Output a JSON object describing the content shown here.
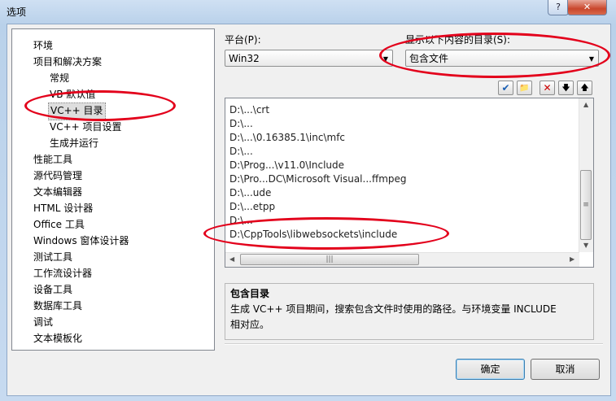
{
  "window": {
    "title": "选项",
    "help_label": "?",
    "close_label": "✕"
  },
  "tree": {
    "items": [
      {
        "label": "环境",
        "level": 0
      },
      {
        "label": "项目和解决方案",
        "level": 0
      },
      {
        "label": "常规",
        "level": 1
      },
      {
        "label": "VB 默认值",
        "level": 1
      },
      {
        "label": "VC++ 目录",
        "level": 1,
        "selected": true
      },
      {
        "label": "VC++ 项目设置",
        "level": 1
      },
      {
        "label": "生成并运行",
        "level": 1
      },
      {
        "label": "性能工具",
        "level": 0
      },
      {
        "label": "源代码管理",
        "level": 0
      },
      {
        "label": "文本编辑器",
        "level": 0
      },
      {
        "label": "HTML 设计器",
        "level": 0
      },
      {
        "label": "Office 工具",
        "level": 0
      },
      {
        "label": "Windows 窗体设计器",
        "level": 0
      },
      {
        "label": "测试工具",
        "level": 0
      },
      {
        "label": "工作流设计器",
        "level": 0
      },
      {
        "label": "设备工具",
        "level": 0
      },
      {
        "label": "数据库工具",
        "level": 0
      },
      {
        "label": "调试",
        "level": 0
      },
      {
        "label": "文本模板化",
        "level": 0
      }
    ]
  },
  "platform": {
    "label": "平台(P):",
    "value": "Win32"
  },
  "show_dirs": {
    "label": "显示以下内容的目录(S):",
    "value": "包含文件"
  },
  "toolbar": {
    "new_line": "✔",
    "new_folder": "📁",
    "delete": "✕",
    "move_down": "🡇",
    "move_up": "🡅"
  },
  "paths": [
    "D:\\...\\crt",
    "D:\\...",
    "D:\\...\\0.16385.1\\inc\\mfc",
    "D:\\...",
    "D:\\Prog...\\v11.0\\Include",
    "D:\\Pro...DC\\Microsoft Visual...ffmpeg",
    "D:\\...ude",
    "D:\\...etpp",
    "D:\\...",
    "D:\\CppTools\\libwebsockets\\include"
  ],
  "description": {
    "title": "包含目录",
    "text": "生成 VC++ 项目期间，搜索包含文件时使用的路径。与环境变量 INCLUDE 相对应。"
  },
  "buttons": {
    "ok": "确定",
    "cancel": "取消"
  },
  "colors": {
    "annotation": "#e3001b"
  }
}
